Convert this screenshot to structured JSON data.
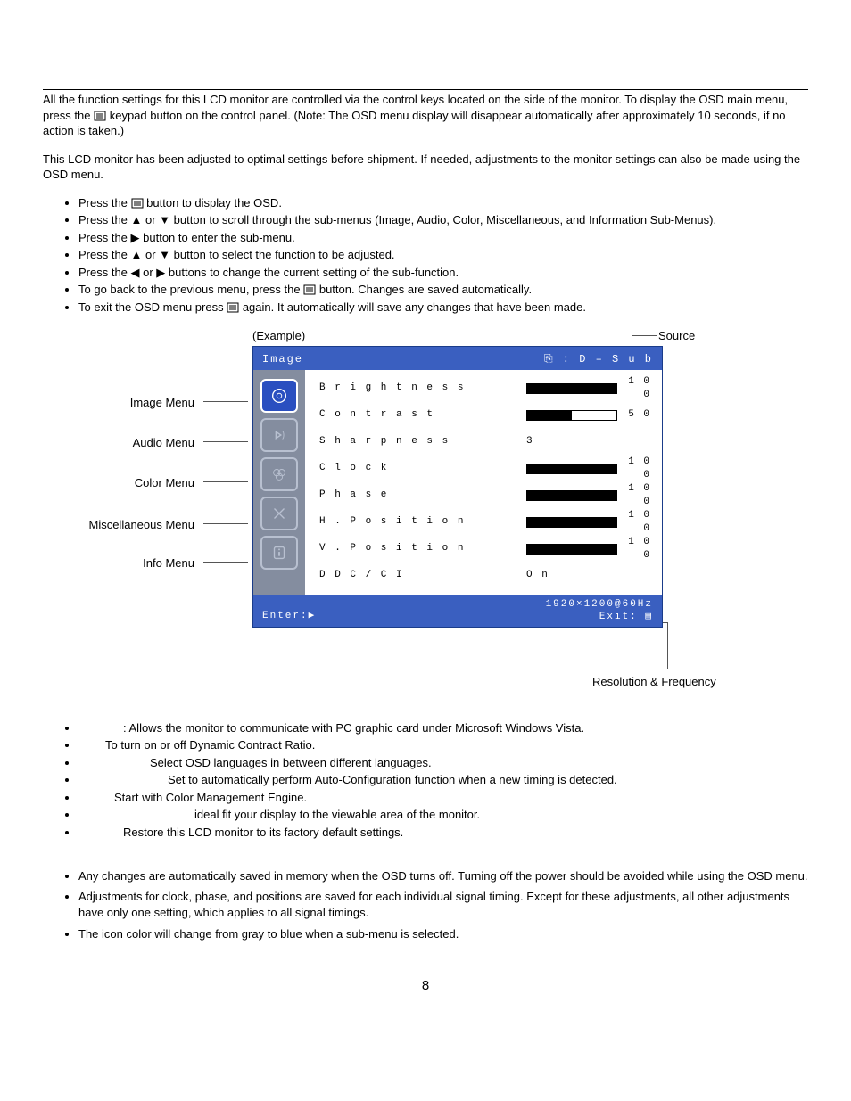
{
  "intro1": "All the function settings for this LCD monitor are controlled via the control keys located on the side of the monitor. To display the OSD main menu, press the",
  "intro1b": "keypad button on the control panel. (Note: The OSD menu display will disappear automatically after approximately 10 seconds, if no action is taken.)",
  "intro2": "This LCD monitor has been adjusted to optimal settings before shipment. If needed, adjustments to the monitor settings can also be made using the OSD menu.",
  "steps": {
    "s1a": "Press the",
    "s1b": "button to display the OSD.",
    "s2": "Press the ▲ or ▼ button to scroll through the sub-menus (Image, Audio, Color, Miscellaneous, and Information Sub-Menus).",
    "s3": "Press the ▶ button to enter the sub-menu.",
    "s4": "Press the ▲ or ▼ button to select the function to be adjusted.",
    "s5": "Press the ◀ or ▶ buttons to change the current setting of the sub-function.",
    "s6a": "To go back to the previous menu, press the",
    "s6b": "button. Changes are saved automatically.",
    "s7a": "To exit the OSD menu press",
    "s7b": "again. It automatically will save any changes that have been made."
  },
  "labels": {
    "example": "(Example)",
    "source": "Source",
    "image_menu": "Image Menu",
    "audio_menu": "Audio  Menu",
    "color_menu": "Color Menu",
    "misc_menu": "Miscellaneous Menu",
    "info_menu": "Info Menu",
    "res_freq": "Resolution & Frequency"
  },
  "osd": {
    "title": "Image",
    "source": "⎘ : D – S u b",
    "rows": [
      {
        "name": "Brightness",
        "val": "100",
        "fill": 100
      },
      {
        "name": "Contrast",
        "val": "50",
        "fill": 50
      },
      {
        "name": "Sharpness",
        "val": "3",
        "fill": null
      },
      {
        "name": "Clock",
        "val": "100",
        "fill": 100
      },
      {
        "name": "Phase",
        "val": "100",
        "fill": 100
      },
      {
        "name": "H. Position",
        "val": "100",
        "fill": 100
      },
      {
        "name": "V. Position",
        "val": "100",
        "fill": 100
      },
      {
        "name": "DDC/CI",
        "val": "On",
        "fill": null
      }
    ],
    "resolution": "1920×1200@60Hz",
    "enter": "Enter:▶",
    "exit": "Exit: ▤"
  },
  "defs": [
    ": Allows the monitor to communicate with PC graphic card under Microsoft Windows Vista.",
    "To turn on or off Dynamic Contract Ratio.",
    "Select OSD languages in between different languages.",
    "Set to automatically perform Auto-Configuration function when a new timing is detected.",
    "Start with Color Management Engine.",
    "ideal fit your display to the viewable area of the monitor.",
    "Restore this LCD monitor to its factory default settings."
  ],
  "def_indents": [
    50,
    30,
    80,
    100,
    40,
    130,
    50
  ],
  "notes": [
    "Any changes are automatically saved in memory when the OSD turns off. Turning off the power should be avoided while using the OSD menu.",
    "Adjustments for clock, phase, and positions are saved for each individual signal timing. Except for these adjustments, all other adjustments have only one setting, which applies to all signal timings.",
    "The icon color will change from gray to blue when a sub-menu is selected."
  ],
  "page_number": "8"
}
